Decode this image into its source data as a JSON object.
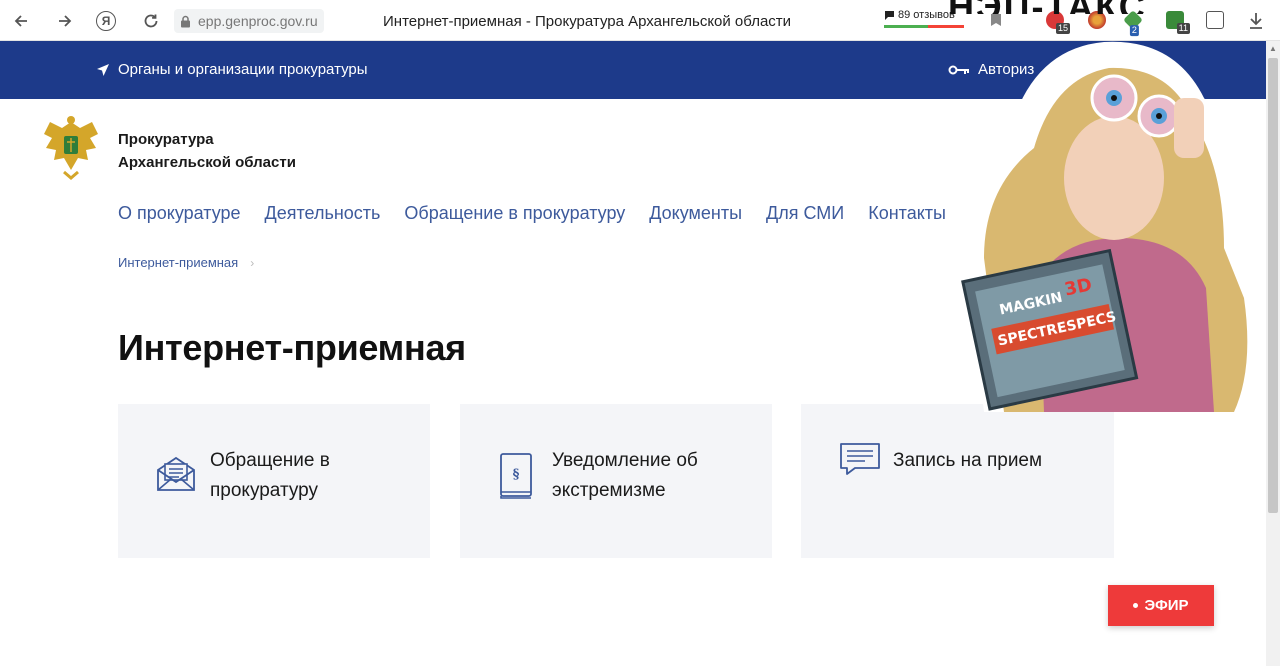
{
  "browser": {
    "url": "epp.genproc.gov.ru",
    "tab_title": "Интернет-приемная - Прокуратура Архангельской области",
    "reviews": "89 отзывов",
    "ext_badges": [
      "15",
      "2",
      "11"
    ]
  },
  "topbar": {
    "orgs_label": "Органы и организации прокуратуры",
    "auth_label": "Авториз"
  },
  "org": {
    "line1": "Прокуратура",
    "line2": "Архангельской области"
  },
  "nav": {
    "items": [
      "О прокуратуре",
      "Деятельность",
      "Обращение в прокуратуру",
      "Документы",
      "Для СМИ",
      "Контакты"
    ]
  },
  "breadcrumb": {
    "current": "Интернет-приемная",
    "separator": "›"
  },
  "page": {
    "title": "Интернет-приемная"
  },
  "cards": [
    {
      "line1": "Обращение в",
      "line2": "прокуратуру",
      "icon": "envelope-icon"
    },
    {
      "line1": "Уведомление об",
      "line2": "экстремизме",
      "icon": "law-book-icon"
    },
    {
      "line1": "Запись на прием",
      "line2": "",
      "icon": "chat-message-icon"
    }
  ],
  "sticker": {
    "caption": "НЭП-ТАКС"
  },
  "live": {
    "label": "ЭФИР"
  },
  "colors": {
    "brand_blue": "#1d3a8a",
    "link_blue": "#3d5a9c",
    "card_bg": "#f4f5f8",
    "live_red": "#ee3a3a"
  }
}
